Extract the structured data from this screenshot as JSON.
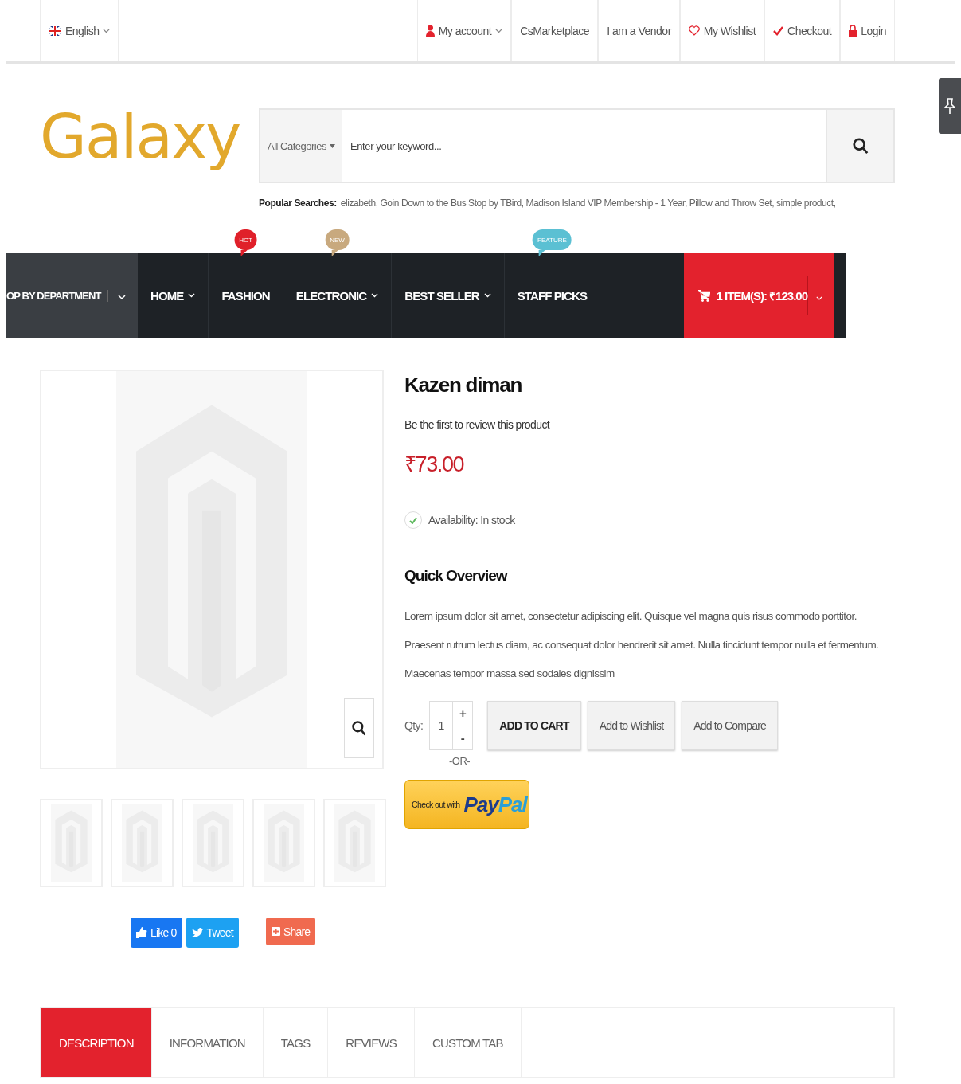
{
  "top_bar": {
    "language": {
      "label": "English"
    },
    "links": [
      {
        "label": "My account",
        "kind": "account"
      },
      {
        "label": "CsMarketplace",
        "kind": "plain"
      },
      {
        "label": "I am a Vendor",
        "kind": "plain"
      },
      {
        "label": "My Wishlist",
        "kind": "wishlist"
      },
      {
        "label": "Checkout",
        "kind": "checkout"
      },
      {
        "label": "Login",
        "kind": "login"
      }
    ]
  },
  "logo": {
    "text": "Galaxy"
  },
  "search": {
    "category": "All Categories",
    "placeholder": "Enter your keyword..."
  },
  "popular_searches": {
    "label": "Popular Searches:",
    "text": "elizabeth, Goin Down to the Bus Stop by TBird, Madison Island VIP Membership - 1 Year, Pillow and Throw Set, simple product,"
  },
  "nav": {
    "department": "OP BY DEPARTMENT",
    "items": [
      {
        "label": "HOME",
        "dropdown": true
      },
      {
        "label": "FASHION",
        "dropdown": false,
        "badge": {
          "text": "HOT",
          "color": "#e0202a"
        }
      },
      {
        "label": "ELECTRONIC",
        "dropdown": true,
        "badge": {
          "text": "NEW",
          "color": "#c8a97e"
        }
      },
      {
        "label": "BEST SELLER",
        "dropdown": true
      },
      {
        "label": "STAFF PICKS",
        "dropdown": false,
        "badge": {
          "text": "FEATURE",
          "color": "#5bc0d3"
        }
      }
    ],
    "cart": "1 ITEM(S): ₹123.00"
  },
  "product": {
    "title": "Kazen diman",
    "review_link": "Be the first to review this product",
    "price": "₹73.00",
    "availability": "Availability: In stock",
    "overview_title": "Quick Overview",
    "overview": "Lorem ipsum dolor sit amet, consectetur adipiscing elit. Quisque vel magna quis risus commodo porttitor. Praesent rutrum lectus diam, ac consequat dolor hendrerit sit amet. Nulla tincidunt tempor nulla et fermentum. Maecenas tempor massa sed sodales dignissim",
    "qty_label": "Qty:",
    "qty": "1",
    "plus": "+",
    "minus": "-",
    "buttons": [
      {
        "label": "ADD TO CART",
        "kind": "primary"
      },
      {
        "label": "Add to Wishlist",
        "kind": "secondary"
      },
      {
        "label": "Add to Compare",
        "kind": "secondary"
      }
    ],
    "or": "-OR-",
    "paypal": {
      "prefix": "Check out with",
      "logo_parts": [
        "Pay",
        "Pal"
      ]
    }
  },
  "social": [
    {
      "label": "Like 0",
      "kind": "like"
    },
    {
      "label": "Tweet",
      "kind": "tweet"
    },
    {
      "label": "Share",
      "kind": "share"
    }
  ],
  "tabs": [
    {
      "label": "DESCRIPTION",
      "selected": true
    },
    {
      "label": "INFORMATION",
      "selected": false
    },
    {
      "label": "TAGS",
      "selected": false
    },
    {
      "label": "REVIEWS",
      "selected": false
    },
    {
      "label": "CUSTOM TAB",
      "selected": false
    }
  ]
}
